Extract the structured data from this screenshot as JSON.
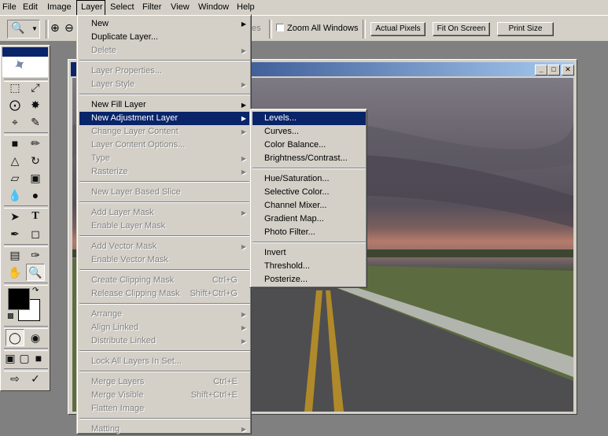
{
  "menubar": [
    "File",
    "Edit",
    "Image",
    "Layer",
    "Select",
    "Filter",
    "View",
    "Window",
    "Help"
  ],
  "options": {
    "partial_text": "es",
    "zoom_all_label": "Zoom All Windows",
    "actual_pixels": "Actual Pixels",
    "fit_on_screen": "Fit On Screen",
    "print_size": "Print Size"
  },
  "layer_menu": {
    "items": [
      {
        "label": "New",
        "shortcut": "",
        "submenu": true,
        "disabled": false
      },
      {
        "label": "Duplicate Layer...",
        "shortcut": "",
        "submenu": false,
        "disabled": false
      },
      {
        "label": "Delete",
        "shortcut": "",
        "submenu": true,
        "disabled": true
      },
      {
        "label": "Layer Properties...",
        "shortcut": "",
        "submenu": false,
        "disabled": true
      },
      {
        "label": "Layer Style",
        "shortcut": "",
        "submenu": true,
        "disabled": true
      },
      {
        "label": "New Fill Layer",
        "shortcut": "",
        "submenu": true,
        "disabled": false
      },
      {
        "label": "New Adjustment Layer",
        "shortcut": "",
        "submenu": true,
        "disabled": false
      },
      {
        "label": "Change Layer Content",
        "shortcut": "",
        "submenu": true,
        "disabled": true
      },
      {
        "label": "Layer Content Options...",
        "shortcut": "",
        "submenu": false,
        "disabled": true
      },
      {
        "label": "Type",
        "shortcut": "",
        "submenu": true,
        "disabled": true
      },
      {
        "label": "Rasterize",
        "shortcut": "",
        "submenu": true,
        "disabled": true
      },
      {
        "label": "New Layer Based Slice",
        "shortcut": "",
        "submenu": false,
        "disabled": true
      },
      {
        "label": "Add Layer Mask",
        "shortcut": "",
        "submenu": true,
        "disabled": true
      },
      {
        "label": "Enable Layer Mask",
        "shortcut": "",
        "submenu": false,
        "disabled": true
      },
      {
        "label": "Add Vector Mask",
        "shortcut": "",
        "submenu": true,
        "disabled": true
      },
      {
        "label": "Enable Vector Mask",
        "shortcut": "",
        "submenu": false,
        "disabled": true
      },
      {
        "label": "Create Clipping Mask",
        "shortcut": "Ctrl+G",
        "submenu": false,
        "disabled": true
      },
      {
        "label": "Release Clipping Mask",
        "shortcut": "Shift+Ctrl+G",
        "submenu": false,
        "disabled": true
      },
      {
        "label": "Arrange",
        "shortcut": "",
        "submenu": true,
        "disabled": true
      },
      {
        "label": "Align Linked",
        "shortcut": "",
        "submenu": true,
        "disabled": true
      },
      {
        "label": "Distribute Linked",
        "shortcut": "",
        "submenu": true,
        "disabled": true
      },
      {
        "label": "Lock All Layers In Set...",
        "shortcut": "",
        "submenu": false,
        "disabled": true
      },
      {
        "label": "Merge Layers",
        "shortcut": "Ctrl+E",
        "submenu": false,
        "disabled": true
      },
      {
        "label": "Merge Visible",
        "shortcut": "Shift+Ctrl+E",
        "submenu": false,
        "disabled": true
      },
      {
        "label": "Flatten Image",
        "shortcut": "",
        "submenu": false,
        "disabled": true
      },
      {
        "label": "Matting",
        "shortcut": "",
        "submenu": true,
        "disabled": true
      }
    ]
  },
  "adjustment_submenu": {
    "items": [
      "Levels...",
      "Curves...",
      "Color Balance...",
      "Brightness/Contrast...",
      "Hue/Saturation...",
      "Selective Color...",
      "Channel Mixer...",
      "Gradient Map...",
      "Photo Filter...",
      "Invert",
      "Threshold...",
      "Posterize..."
    ]
  },
  "colors": {
    "menu_bg": "#d4d0c8",
    "highlight": "#0a246a",
    "disabled_text": "#808080",
    "foreground_swatch": "#000000",
    "background_swatch": "#ffffff"
  },
  "tools": [
    "marquee-icon",
    "move-icon",
    "lasso-icon",
    "magic-wand-icon",
    "crop-icon",
    "slice-icon",
    "healing-brush-icon",
    "brush-icon",
    "stamp-icon",
    "history-brush-icon",
    "eraser-icon",
    "gradient-icon",
    "blur-icon",
    "dodge-icon",
    "path-selection-icon",
    "type-icon",
    "pen-icon",
    "shape-icon",
    "notes-icon",
    "eyedropper-icon",
    "hand-icon",
    "zoom-icon"
  ]
}
